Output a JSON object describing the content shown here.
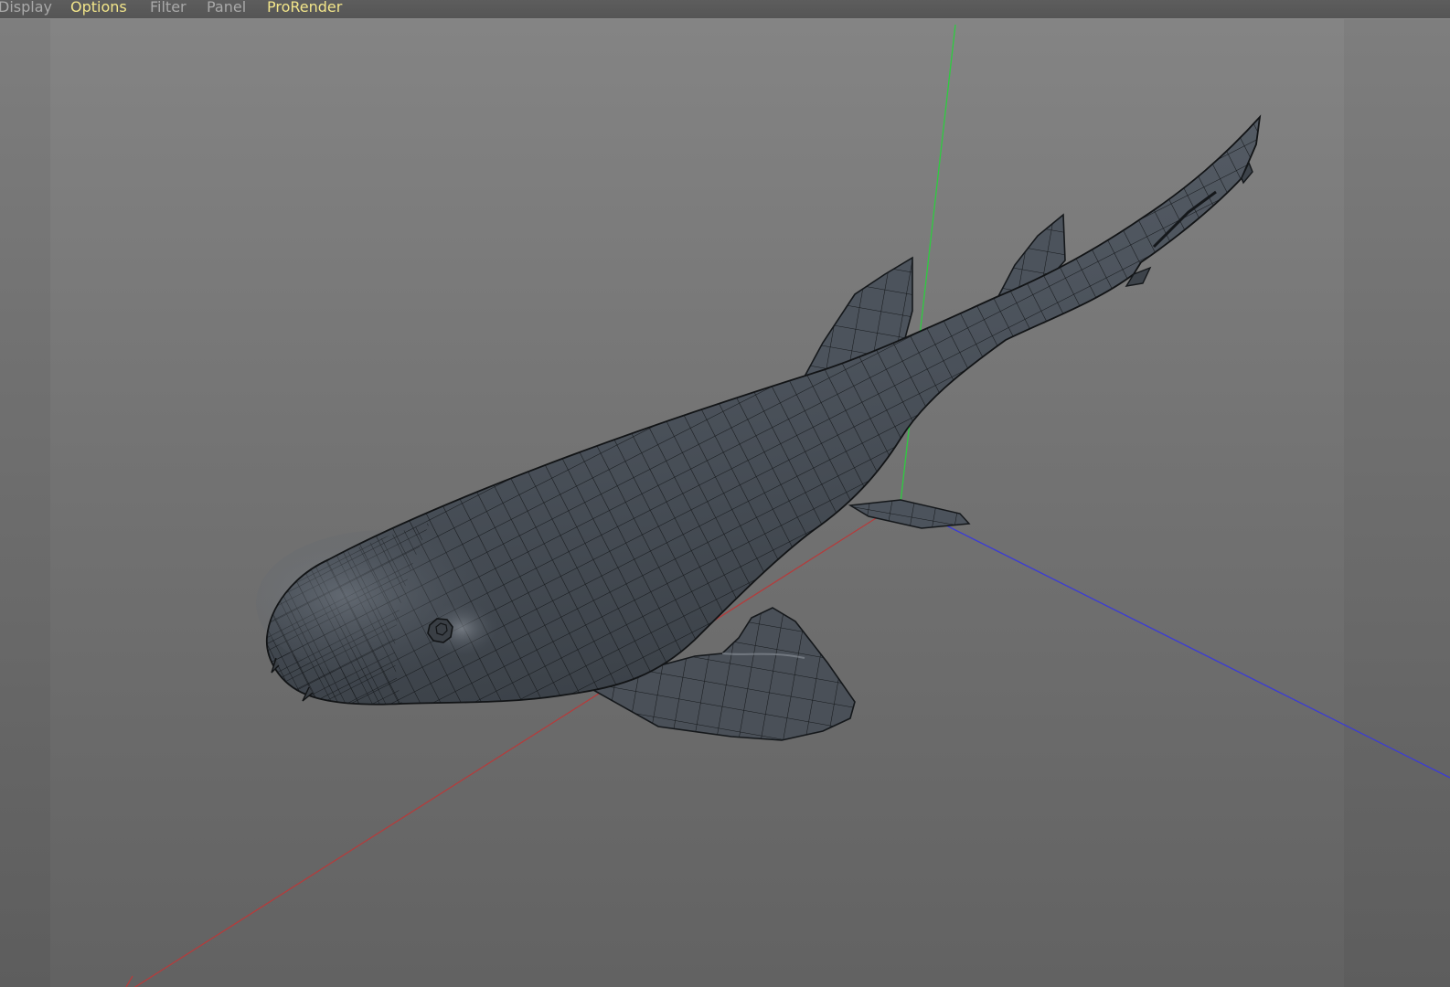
{
  "menubar": {
    "items": [
      {
        "label": "Display",
        "state": "dim"
      },
      {
        "label": "Options",
        "state": "highlighted"
      },
      {
        "label": "Filter",
        "state": "dim"
      },
      {
        "label": "Panel",
        "state": "dim"
      },
      {
        "label": "ProRender",
        "state": "highlighted"
      }
    ]
  },
  "viewport": {
    "object": "shark wireframe mesh",
    "axes": {
      "x_color": "#c0392b",
      "y_color": "#2ecc40",
      "z_color": "#3b3bd6"
    },
    "background_top": "#848484",
    "background_bottom": "#626262",
    "mesh_color": "#4c535c",
    "wire_color": "#15181b"
  }
}
